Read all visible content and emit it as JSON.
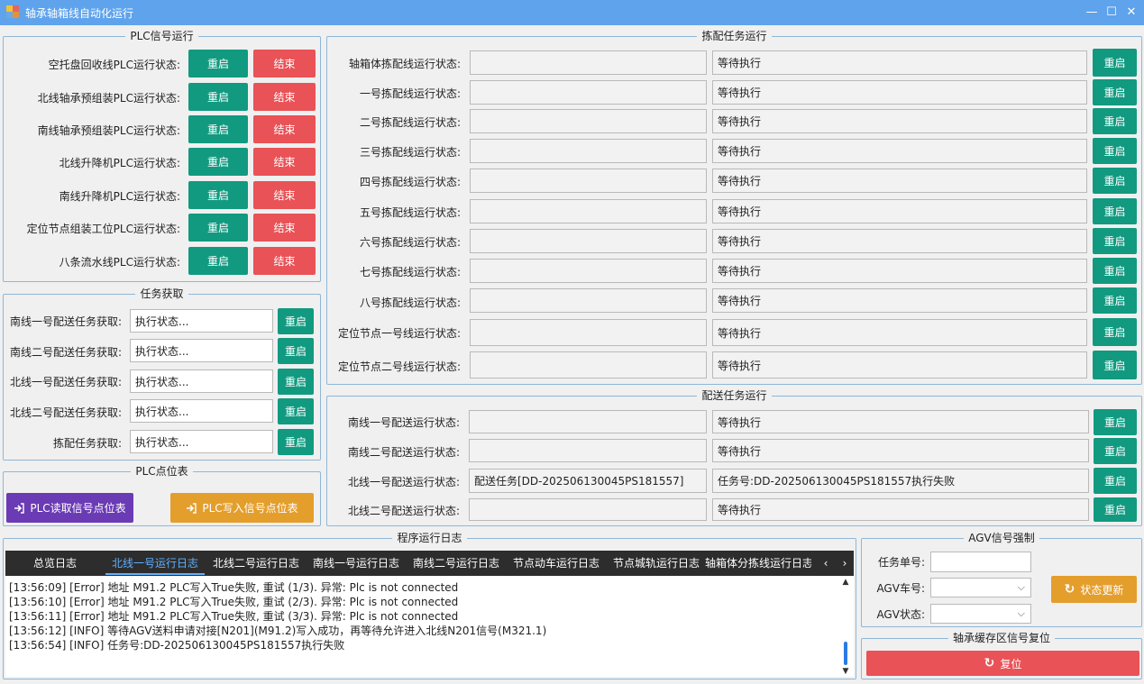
{
  "window": {
    "title": "轴承轴箱线自动化运行",
    "minimize": "—",
    "maximize": "☐",
    "close": "✕"
  },
  "plc_run": {
    "legend": "PLC信号运行",
    "restart": "重启",
    "end": "结束",
    "rows": [
      "空托盘回收线PLC运行状态:",
      "北线轴承预组装PLC运行状态:",
      "南线轴承预组装PLC运行状态:",
      "北线升降机PLC运行状态:",
      "南线升降机PLC运行状态:",
      "定位节点组装工位PLC运行状态:",
      "八条流水线PLC运行状态:"
    ]
  },
  "task_fetch": {
    "legend": "任务获取",
    "restart": "重启",
    "rows": [
      {
        "label": "南线一号配送任务获取:",
        "value": "执行状态..."
      },
      {
        "label": "南线二号配送任务获取:",
        "value": "执行状态..."
      },
      {
        "label": "北线一号配送任务获取:",
        "value": "执行状态..."
      },
      {
        "label": "北线二号配送任务获取:",
        "value": "执行状态..."
      },
      {
        "label": "拣配任务获取:",
        "value": "执行状态..."
      }
    ]
  },
  "plc_points": {
    "legend": "PLC点位表",
    "read_label": "PLC读取信号点位表",
    "write_label": "PLC写入信号点位表"
  },
  "pick_tasks": {
    "legend": "拣配任务运行",
    "restart": "重启",
    "rows": [
      {
        "label": "轴箱体拣配线运行状态:",
        "field1": "",
        "field2": "等待执行"
      },
      {
        "label": "一号拣配线运行状态:",
        "field1": "",
        "field2": "等待执行"
      },
      {
        "label": "二号拣配线运行状态:",
        "field1": "",
        "field2": "等待执行"
      },
      {
        "label": "三号拣配线运行状态:",
        "field1": "",
        "field2": "等待执行"
      },
      {
        "label": "四号拣配线运行状态:",
        "field1": "",
        "field2": "等待执行"
      },
      {
        "label": "五号拣配线运行状态:",
        "field1": "",
        "field2": "等待执行"
      },
      {
        "label": "六号拣配线运行状态:",
        "field1": "",
        "field2": "等待执行"
      },
      {
        "label": "七号拣配线运行状态:",
        "field1": "",
        "field2": "等待执行"
      },
      {
        "label": "八号拣配线运行状态:",
        "field1": "",
        "field2": "等待执行"
      },
      {
        "label": "定位节点一号线运行状态:",
        "field1": "",
        "field2": "等待执行"
      },
      {
        "label": "定位节点二号线运行状态:",
        "field1": "",
        "field2": "等待执行"
      }
    ]
  },
  "delivery_tasks": {
    "legend": "配送任务运行",
    "restart": "重启",
    "rows": [
      {
        "label": "南线一号配送运行状态:",
        "field1": "",
        "field2": "等待执行"
      },
      {
        "label": "南线二号配送运行状态:",
        "field1": "",
        "field2": "等待执行"
      },
      {
        "label": "北线一号配送运行状态:",
        "field1": "配送任务[DD-202506130045PS181557]",
        "field2": "任务号:DD-202506130045PS181557执行失败"
      },
      {
        "label": "北线二号配送运行状态:",
        "field1": "",
        "field2": "等待执行"
      }
    ]
  },
  "logs": {
    "legend": "程序运行日志",
    "tabs": [
      "总览日志",
      "北线一号运行日志",
      "北线二号运行日志",
      "南线一号运行日志",
      "南线二号运行日志",
      "节点动车运行日志",
      "节点城轨运行日志",
      "轴箱体分拣线运行日志"
    ],
    "active_tab": 1,
    "lines": [
      "[13:56:09] [Error] 地址 M91.2 PLC写入True失败, 重试 (1/3). 异常: Plc is not connected",
      "[13:56:10] [Error] 地址 M91.2 PLC写入True失败, 重试 (2/3). 异常: Plc is not connected",
      "[13:56:11] [Error] 地址 M91.2 PLC写入True失败, 重试 (3/3). 异常: Plc is not connected",
      "[13:56:12] [INFO] 等待AGV送料申请对接[N201](M91.2)写入成功，再等待允许进入北线N201信号(M321.1)",
      "[13:56:54] [INFO] 任务号:DD-202506130045PS181557执行失败"
    ]
  },
  "agv": {
    "legend": "AGV信号强制",
    "task_label": "任务单号:",
    "task_value": "",
    "car_label": "AGV车号:",
    "car_value": "",
    "state_label": "AGV状态:",
    "state_value": "",
    "update_label": "状态更新"
  },
  "buffer": {
    "legend": "轴承缓存区信号复位",
    "reset_label": "复位"
  },
  "colors": {
    "titlebar": "#5ea3ec",
    "teal": "#119a80",
    "red": "#e95256",
    "orange": "#e49e2c",
    "purple": "#6a3bb4",
    "tabbar": "#2d2d2d",
    "active_tab": "#60b0ff"
  }
}
